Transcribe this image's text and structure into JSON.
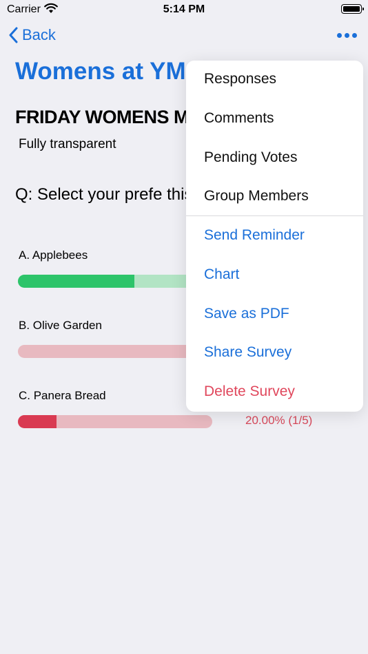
{
  "status_bar": {
    "carrier": "Carrier",
    "time": "5:14 PM"
  },
  "nav": {
    "back_label": "Back"
  },
  "page_title": "Womens at YM",
  "survey": {
    "title": "FRIDAY WOMENS ME",
    "subtitle": "Fully transparent",
    "question": "Q: Select your prefe this Friday.",
    "options": [
      {
        "label": "A. Applebees",
        "fill_fraction": 0.6,
        "fill_color": "#2dc46a",
        "track_color": "#b2e4c4",
        "percent_text": ""
      },
      {
        "label": "B. Olive Garden",
        "fill_fraction": 0.0,
        "fill_color": "#d93a52",
        "track_color": "#e8b9c0",
        "percent_text": ""
      },
      {
        "label": "C. Panera Bread",
        "fill_fraction": 0.2,
        "fill_color": "#d93a52",
        "track_color": "#e8b9c0",
        "percent_text": "20.00% (1/5)"
      }
    ]
  },
  "menu": {
    "items": [
      {
        "label": "Responses",
        "style": "dark"
      },
      {
        "label": "Comments",
        "style": "dark"
      },
      {
        "label": "Pending Votes",
        "style": "dark"
      },
      {
        "label": "Group Members",
        "style": "dark"
      },
      {
        "label": "Send Reminder",
        "style": "blue"
      },
      {
        "label": "Chart",
        "style": "blue"
      },
      {
        "label": "Save as PDF",
        "style": "blue"
      },
      {
        "label": "Share Survey",
        "style": "blue"
      },
      {
        "label": "Delete Survey",
        "style": "red"
      }
    ]
  },
  "colors": {
    "accent": "#1a6fd9",
    "destructive": "#e0475c",
    "background": "#efeff4"
  }
}
